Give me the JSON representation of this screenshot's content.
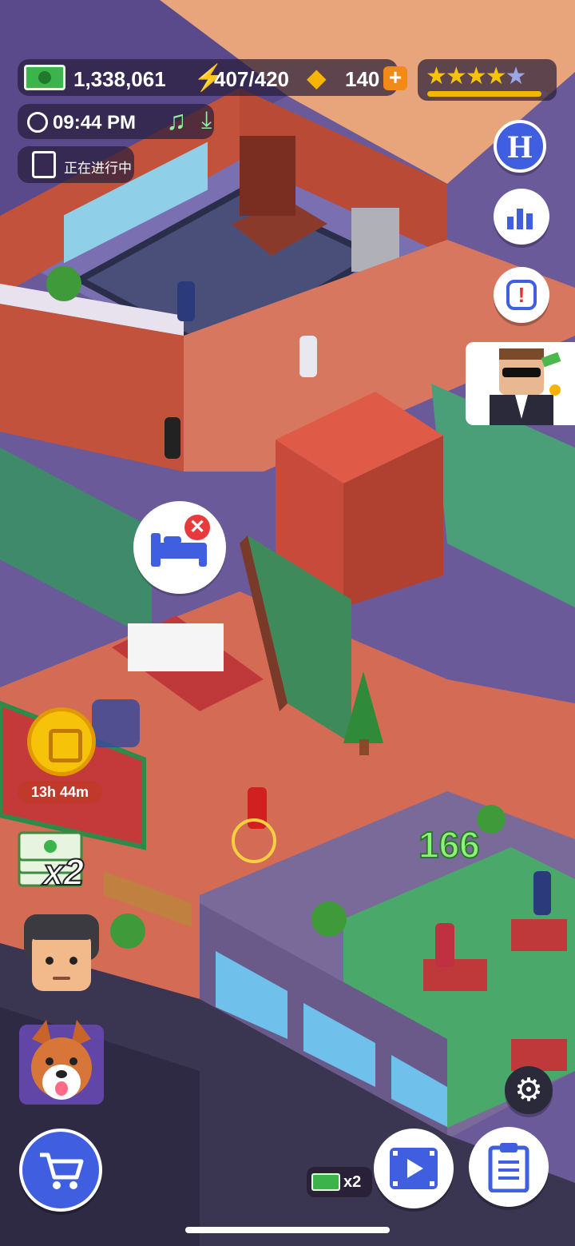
{
  "hud": {
    "cash": "1,338,061",
    "energy": "407/420",
    "gems": "140",
    "time": "09:44 PM",
    "status_text": "正在进行中",
    "rating_stars": 4,
    "rating_max": 5
  },
  "side_buttons": {
    "hotel_letter": "H"
  },
  "scene": {
    "coin_timer": "13h 44m",
    "cash_multiplier": "x2",
    "floating_income": "166"
  },
  "bottom": {
    "ad_multiplier": "x2"
  },
  "colors": {
    "hud_bg": "#2a1f3e",
    "accent_blue": "#3f5fe0",
    "cash_green": "#3cb44b",
    "gold": "#f7b500"
  }
}
